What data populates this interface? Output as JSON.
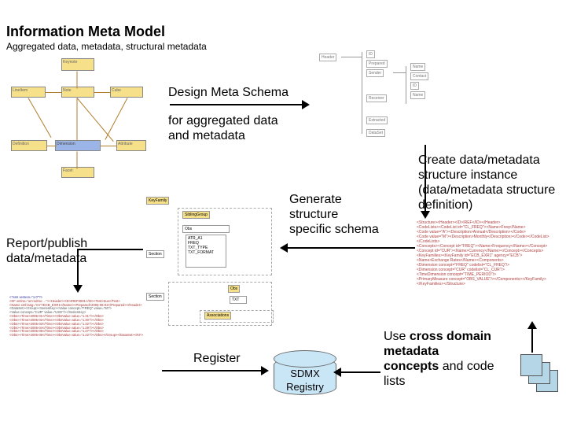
{
  "title": "Information Meta Model",
  "subtitle": "Aggregated data, metadata, structural metadata",
  "labels": {
    "design_line1": "Design Meta Schema",
    "design_line2": "for aggregated data",
    "design_line3": "and metadata",
    "create_line1": "Create data/metadata",
    "create_line2": "structure instance",
    "create_line3": "(data/metadata structure",
    "create_line4": "definition)",
    "generate_line1": "Generate",
    "generate_line2": "structure",
    "generate_line3": "specific schema",
    "report_line1": "Report/publish",
    "report_line2": "data/metadata",
    "register": "Register",
    "use_pre": "Use ",
    "use_b1": "cross domain",
    "use_b2": "metadata",
    "use_b3": "concepts",
    "use_mid": " and code",
    "use_line4": "lists",
    "registry_line1": "SDMX",
    "registry_line2": "Registry"
  },
  "uml1_boxes": [
    "Keynote",
    "LineItem",
    "Note",
    "Cube",
    "Definition",
    "Dimension",
    "Attribute",
    "Facet"
  ],
  "tree_boxes": [
    "Header",
    "ID",
    "Prepared",
    "Sender",
    "Name",
    "Contact",
    "Receiver",
    "Extracted",
    "DataSet"
  ],
  "schema_boxes": [
    "KeyFamily",
    "SiblingGroup",
    "Section",
    "Obs",
    "ATR_A1",
    "FREQ",
    "TXT_TYPE",
    "TXT_FORMAT",
    "Obs",
    "TXT",
    "Associations"
  ],
  "code_lines": [
    "<?xml version=\"1.0\"?>",
    "<KF xmlns=\"urn:sdmx:…\"><Header><ID>IREF0001</ID><Test>true</Test>",
    "<Name xml:lang=\"en\">ECB_EXR1</Name><Prepared>2005-06-03</Prepared></Header>",
    "<DataSet><Group><SeriesKey><Value concept=\"FREQ\" value=\"M\"/>",
    "<Value concept=\"CUR\" value=\"USD\"/></SeriesKey>",
    "<Obs><Time>2005-01</Time><ObsValue value=\"1.31\"/></Obs>",
    "<Obs><Time>2005-02</Time><ObsValue value=\"1.30\"/></Obs>",
    "<Obs><Time>2005-03</Time><ObsValue value=\"1.32\"/></Obs>",
    "<Obs><Time>2005-04</Time><ObsValue value=\"1.29\"/></Obs>",
    "<Obs><Time>2005-05</Time><ObsValue value=\"1.27\"/></Obs>",
    "<Obs><Time>2005-06</Time><ObsValue value=\"1.22\"/></Obs></Group></DataSet></KF>"
  ],
  "def_lines": [
    "<Structure><Header><ID>IREF</ID></Header>",
    "<CodeLists><CodeList id=\"CL_FREQ\"><Name>Freq</Name>",
    "<Code value=\"A\"><Description>Annual</Description></Code>",
    "<Code value=\"M\"><Description>Monthly</Description></Code></CodeList></CodeLists>",
    "<Concepts><Concept id=\"FREQ\"><Name>Frequency</Name></Concept>",
    "<Concept id=\"CUR\"><Name>Currency</Name></Concept></Concepts>",
    "<KeyFamilies><KeyFamily id=\"ECB_EXR1\" agency=\"ECB\">",
    "<Name>Exchange Rates</Name><Components>",
    "<Dimension concept=\"FREQ\" codelist=\"CL_FREQ\"/>",
    "<Dimension concept=\"CUR\" codelist=\"CL_CUR\"/>",
    "<TimeDimension concept=\"TIME_PERIOD\"/>",
    "<PrimaryMeasure concept=\"OBS_VALUE\"/></Components></KeyFamily></KeyFamilies></Structure>"
  ]
}
